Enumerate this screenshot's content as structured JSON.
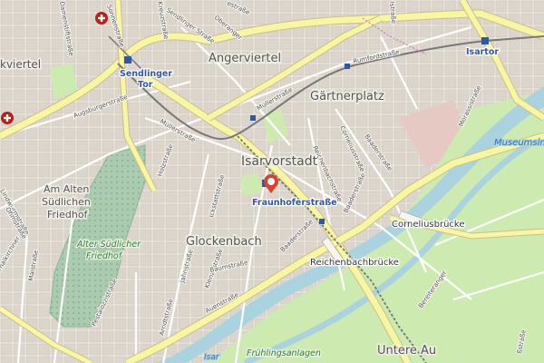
{
  "map": {
    "districts": {
      "angerviertel": "Angerviertel",
      "gaertnerplatz": "Gärtnerplatz",
      "isarvorstadt": "Isarvorstadt",
      "glockenbach": "Glockenbach",
      "kviertel": "kviertel",
      "am_alten": "Am Alten",
      "suedlichen": "Südlichen",
      "friedhof": "Friedhof",
      "untere_au": "Untere Au",
      "museumsinsel": "Museumsins"
    },
    "stations": {
      "sendlinger_tor_1": "Sendlinger",
      "sendlinger_tor_2": "Tor",
      "isartor": "Isartor",
      "fraunhoferstrasse": "Fraunhoferstraße"
    },
    "bridges": {
      "corneliusbruecke": "Corneliusbrücke",
      "reichenbachbruecke": "Reichenbachbrücke"
    },
    "parks": {
      "alter_suedlicher_1": "Alter Südlicher",
      "alter_suedlicher_2": "Friedhof",
      "fruehlingsanlagen": "Frühlingsanlagen"
    },
    "river": "Isar",
    "streets": {
      "sonnenstrasse": "Sonnenstraße",
      "sendlinger_strasse": "Sendlinger Straße",
      "oberanger": "Oberanger",
      "rumfordstrasse": "Rumfordstraße",
      "muellerstrasse_1": "Müllerstraße",
      "muellerstrasse_2": "Müllerstraße",
      "augsburgerstrasse": "Augsburgerstraße",
      "holzstrasse": "Holzstraße",
      "ickstattstrasse": "Ickstattstraße",
      "jahnstrasse": "Jahnstraße",
      "corneliusstrasse": "Corneliusstraße",
      "reichenbachstrasse": "Reichenbachstraße",
      "baaderstrasse_1": "Baaderstraße",
      "baaderstrasse_2": "Baaderstraße",
      "baaderstrasse_3": "Baaderstraße",
      "klenzestrasse": "Klenzestraße",
      "baumstrasse": "Baumstraße",
      "auenstrasse": "Auenstraße",
      "pestalozzistrasse": "Pestalozzistraße",
      "arndtstrasse": "Arndtstraße",
      "maistrasse": "Maistraße",
      "morassistrasse": "Morassistraße",
      "bereiteranger": "Bereiteranger",
      "kreuzstrasse": "Kreuzstraße",
      "damenstiftstrasse": "Damenstiftstraße",
      "lindwurmstrasse": "Lindwurmstraße",
      "thalkirchner": "Thalkirchner",
      "ohmstrasse": "Ohmstraße",
      "kastrasse": "ßstraße",
      "senstrasse": "estraße",
      "lstrasse": "lstraße"
    }
  },
  "colors": {
    "background": "#ece8e1",
    "primary_road": "#f8f5a3",
    "road_casing": "#c9c08a",
    "water": "#aad3df",
    "park": "#cdebb0",
    "cemetery": "#aacbaf",
    "rail": "#777777",
    "station": "#2f57a8",
    "marker": "#d9432c",
    "hospital": "#b5221d"
  },
  "icons": [
    "hospital-icon",
    "location-marker-icon",
    "subway-station-icon"
  ]
}
